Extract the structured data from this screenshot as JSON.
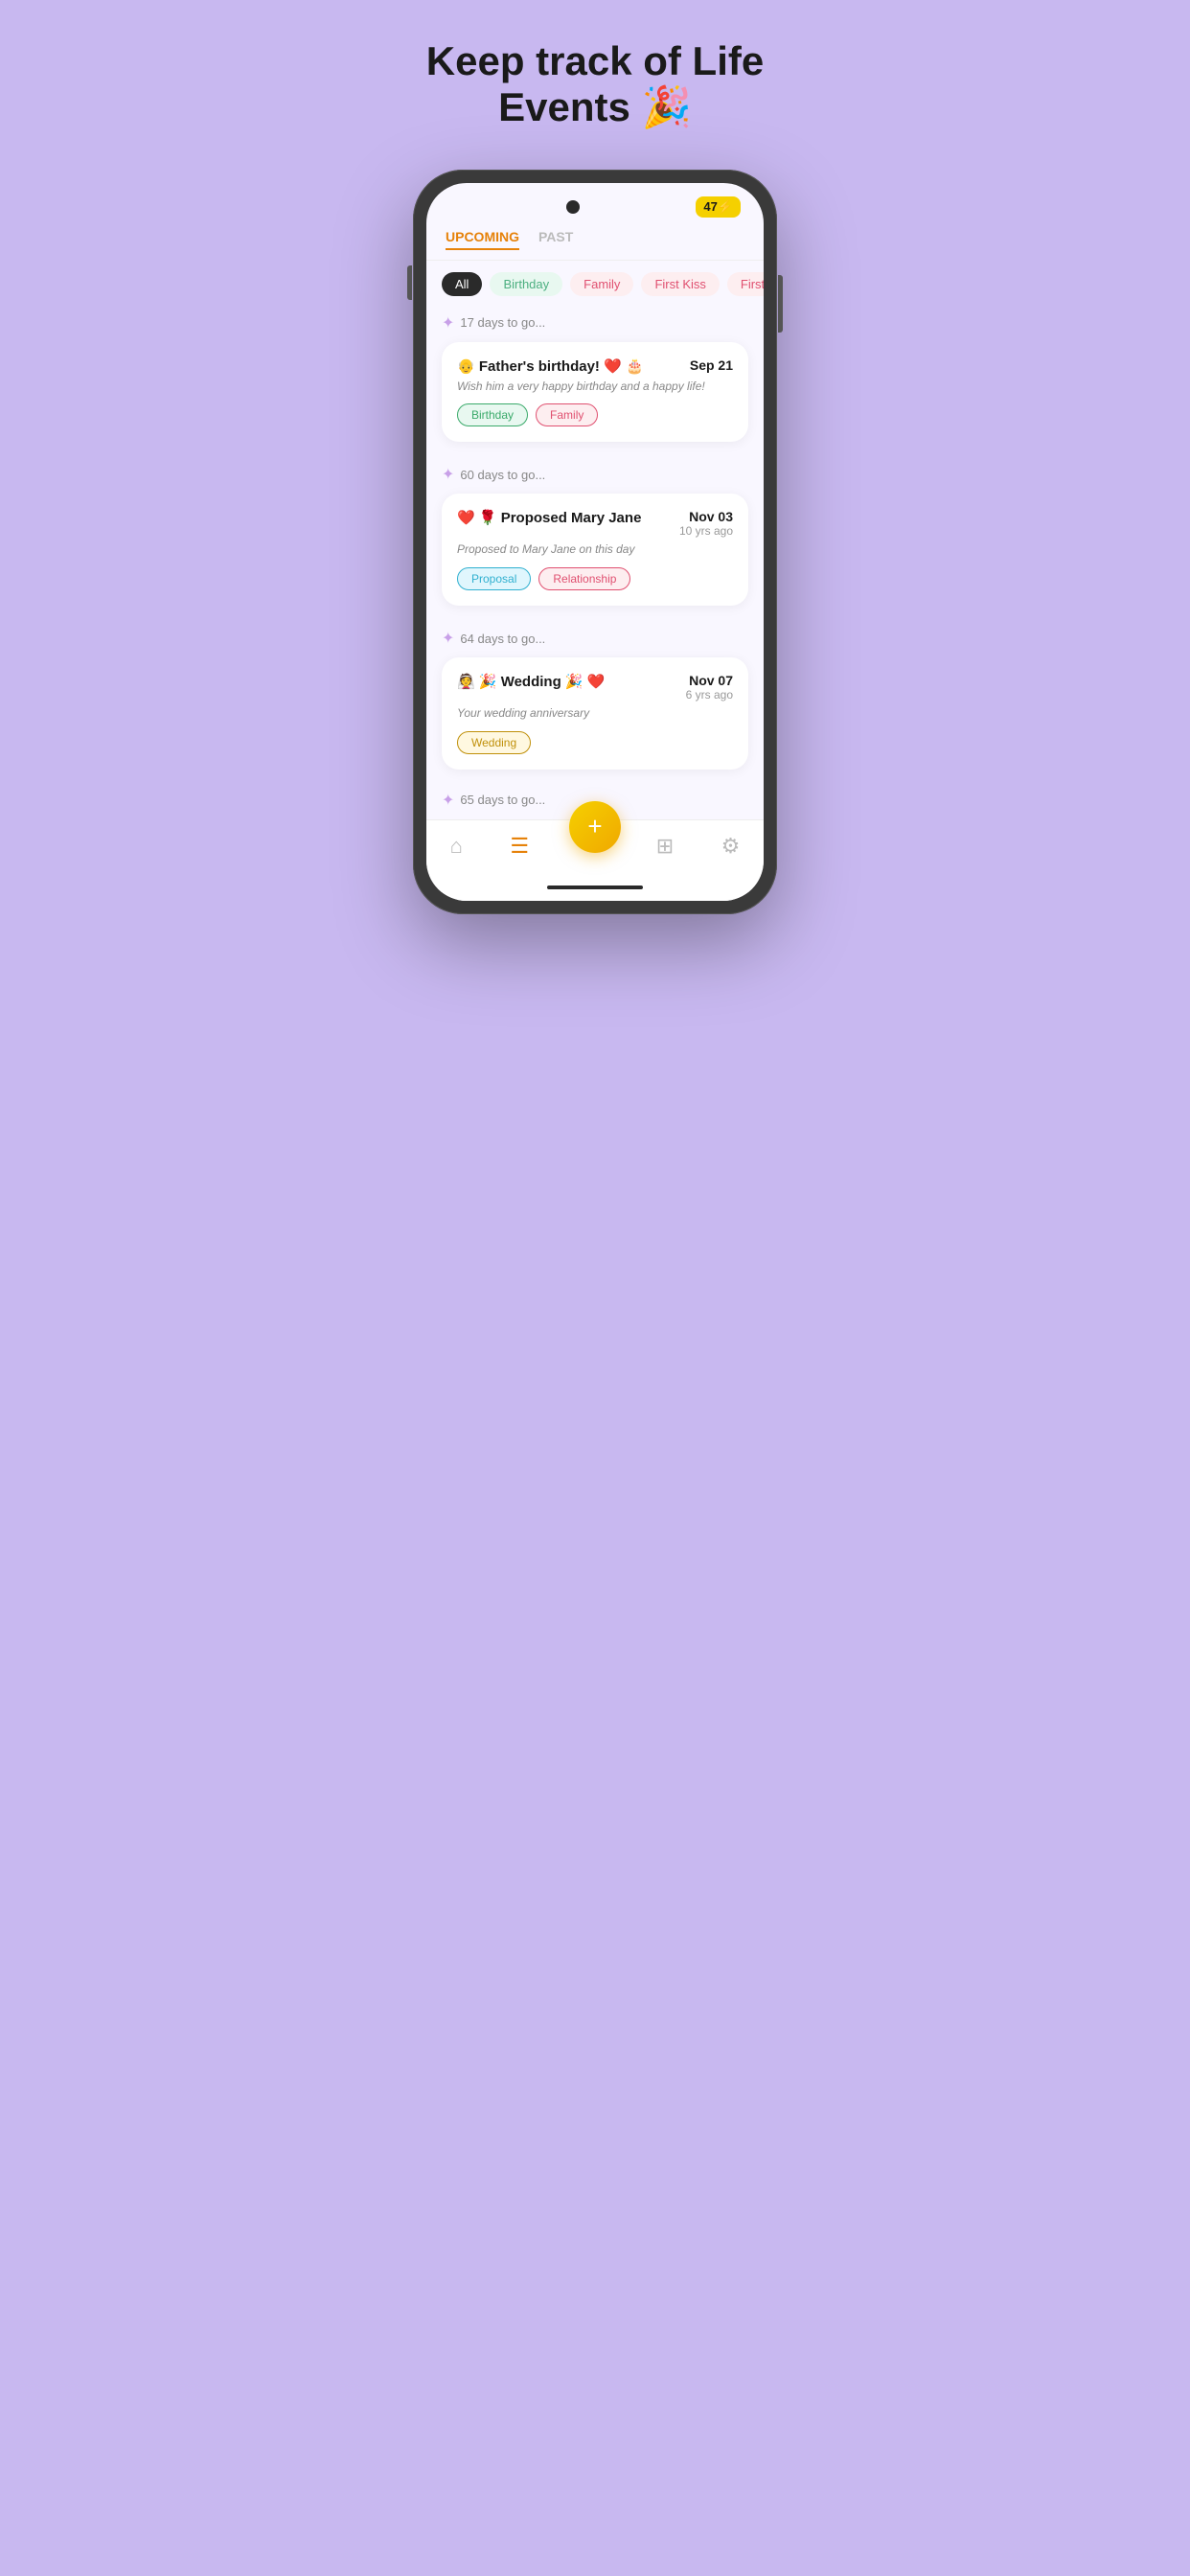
{
  "headline": {
    "line1": "Keep track of Life",
    "line2": "Events 🎉"
  },
  "status_bar": {
    "battery": "47⚡"
  },
  "tabs": [
    {
      "label": "UPCOMING",
      "active": true
    },
    {
      "label": "PAST",
      "active": false
    }
  ],
  "filters": [
    {
      "label": "All",
      "style": "active"
    },
    {
      "label": "Birthday",
      "style": "green"
    },
    {
      "label": "Family",
      "style": "pink"
    },
    {
      "label": "First Kiss",
      "style": "pink"
    },
    {
      "label": "First Meet",
      "style": "pink"
    }
  ],
  "events": [
    {
      "days_label": "17 days to go...",
      "title": "👴 Father's birthday! ❤️ 🎂",
      "description": "Wish him a very happy birthday and a happy life!",
      "date_main": "Sep 21",
      "date_sub": "",
      "tags": [
        {
          "label": "Birthday",
          "style": "tag-birthday"
        },
        {
          "label": "Family",
          "style": "tag-family"
        }
      ]
    },
    {
      "days_label": "60 days to go...",
      "title": "❤️ 🌹 Proposed Mary Jane",
      "description": "Proposed to Mary Jane on this day",
      "date_main": "Nov 03",
      "date_sub": "10 yrs ago",
      "tags": [
        {
          "label": "Proposal",
          "style": "tag-proposal"
        },
        {
          "label": "Relationship",
          "style": "tag-relationship"
        }
      ]
    },
    {
      "days_label": "64 days to go...",
      "title": "👰 🎉 Wedding 🎉 ❤️",
      "description": "Your wedding anniversary",
      "date_main": "Nov 07",
      "date_sub": "6 yrs ago",
      "tags": [
        {
          "label": "Wedding",
          "style": "tag-wedding"
        }
      ]
    }
  ],
  "partial_label": "65 days to go...",
  "fab_label": "+",
  "nav_items": [
    {
      "icon": "🏠",
      "label": "home",
      "active": false
    },
    {
      "icon": "≡",
      "label": "list",
      "active": true
    },
    {
      "icon": "⊞",
      "label": "grid",
      "active": false
    },
    {
      "icon": "⚙",
      "label": "settings",
      "active": false
    }
  ]
}
